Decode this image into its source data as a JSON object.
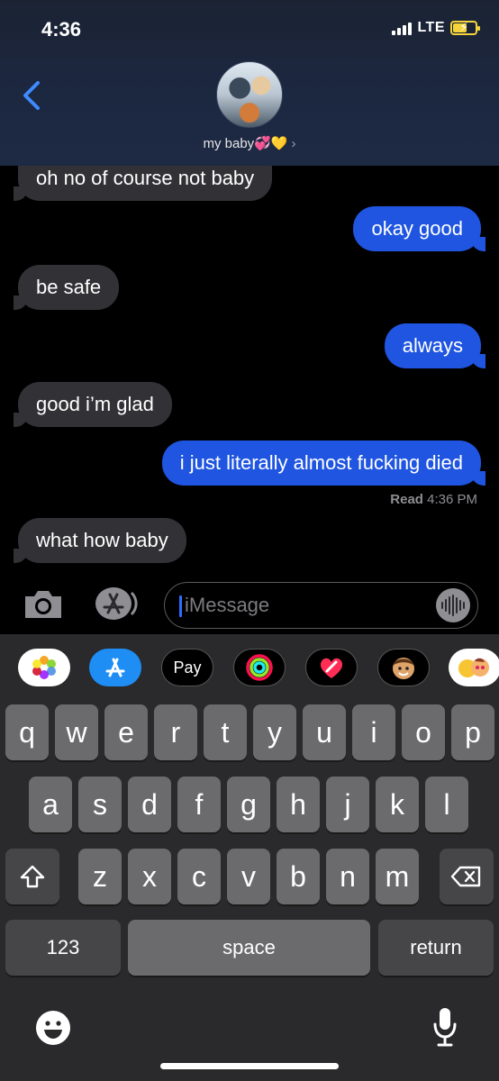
{
  "status": {
    "time": "4:36",
    "network": "LTE"
  },
  "header": {
    "contact_name": "my baby💞💛",
    "back_icon": "chevron-left-icon"
  },
  "messages": [
    {
      "from": "them",
      "text": "oh no of course not baby"
    },
    {
      "from": "me",
      "text": "okay good"
    },
    {
      "from": "them",
      "text": "be safe"
    },
    {
      "from": "me",
      "text": "always"
    },
    {
      "from": "them",
      "text": "good i’m glad"
    },
    {
      "from": "me",
      "text": "i just literally almost fucking died"
    },
    {
      "from": "them",
      "text": "what how baby"
    }
  ],
  "receipt": {
    "label": "Read",
    "time": "4:36 PM"
  },
  "compose": {
    "placeholder": "iMessage"
  },
  "app_drawer": [
    "photos-icon",
    "app-store-icon",
    "apple-pay-icon",
    "activity-icon",
    "digital-touch-icon",
    "memoji-icon",
    "memoji-stickers-icon"
  ],
  "apple_pay_label": "Pay",
  "keyboard": {
    "row1": [
      "q",
      "w",
      "e",
      "r",
      "t",
      "y",
      "u",
      "i",
      "o",
      "p"
    ],
    "row2": [
      "a",
      "s",
      "d",
      "f",
      "g",
      "h",
      "j",
      "k",
      "l"
    ],
    "row3": [
      "z",
      "x",
      "c",
      "v",
      "b",
      "n",
      "m"
    ],
    "numbers": "123",
    "space": "space",
    "return": "return"
  },
  "colors": {
    "outgoing": "#1f55e0",
    "incoming": "#323236",
    "accent": "#2f6cff"
  }
}
